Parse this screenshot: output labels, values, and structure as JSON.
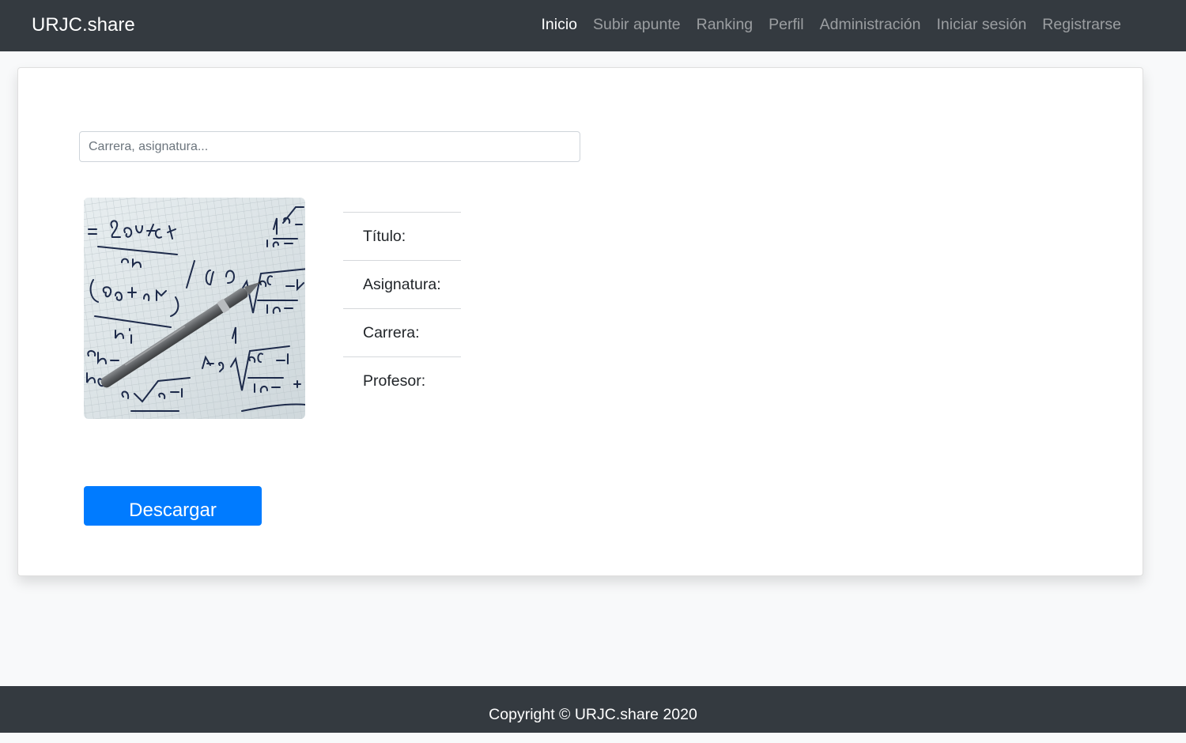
{
  "navbar": {
    "brand": "URJC.share",
    "links": [
      {
        "label": "Inicio",
        "active": true
      },
      {
        "label": "Subir apunte",
        "active": false
      },
      {
        "label": "Ranking",
        "active": false
      },
      {
        "label": "Perfil",
        "active": false
      },
      {
        "label": "Administración",
        "active": false
      },
      {
        "label": "Iniciar sesión",
        "active": false
      },
      {
        "label": "Registrarse",
        "active": false
      }
    ]
  },
  "search": {
    "placeholder": "Carrera, asignatura...",
    "value": ""
  },
  "note": {
    "image": "math-notes-with-pen-photo",
    "fields": [
      {
        "label": "Título:"
      },
      {
        "label": "Asignatura:"
      },
      {
        "label": "Carrera:"
      },
      {
        "label": "Profesor:"
      }
    ],
    "download_label": "Descargar"
  },
  "footer": {
    "text": "Copyright © URJC.share 2020"
  },
  "colors": {
    "navbar_bg": "#343a40",
    "page_bg": "#f8f9fa",
    "primary": "#007bff"
  }
}
